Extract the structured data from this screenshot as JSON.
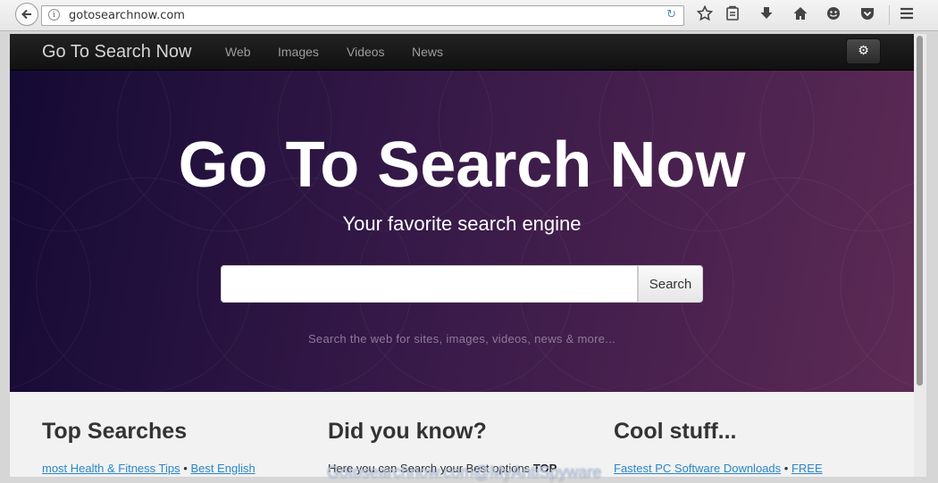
{
  "browser": {
    "url": "gotosearchnow.com",
    "info_glyph": "i",
    "reload_glyph": "↻",
    "toolbar_icons": [
      "bookmark-star-icon",
      "reading-list-icon",
      "download-icon",
      "home-icon",
      "hello-icon",
      "pocket-icon",
      "hamburger-menu-icon"
    ]
  },
  "navbar": {
    "brand": "Go To Search Now",
    "links": [
      "Web",
      "Images",
      "Videos",
      "News"
    ],
    "settings_glyph": "⚙"
  },
  "hero": {
    "title": "Go To Search Now",
    "subtitle": "Your favorite search engine",
    "search_placeholder": "",
    "search_button": "Search",
    "hint": "Search the web for sites, images, videos, news & more..."
  },
  "sections": [
    {
      "heading": "Top Searches",
      "links": [
        "most Health & Fitness Tips",
        "Best English"
      ],
      "separator": "•"
    },
    {
      "heading": "Did you know?",
      "text": "Here you can Search your Best options",
      "bold": "TOP"
    },
    {
      "heading": "Cool stuff...",
      "links": [
        "Fastest PC Software Downloads",
        "FREE"
      ],
      "separator": "•"
    }
  ],
  "watermark": "Gotosearchnow.com@MyAntiSpyware",
  "colors": {
    "navbar": "#1a1a1a",
    "hero_start": "#140a34",
    "hero_end": "#5d2a55",
    "link": "#2a86c8"
  }
}
